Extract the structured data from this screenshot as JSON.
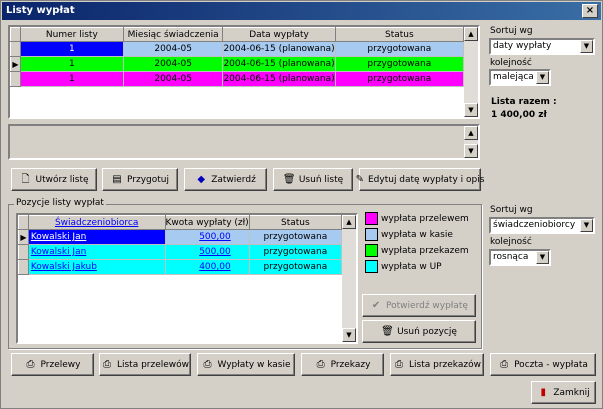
{
  "window": {
    "title": "Listy wypłat",
    "close_label": "×"
  },
  "lists_table": {
    "columns": [
      "Numer listy",
      "Miesiąc świadczenia",
      "Data wypłaty",
      "Status"
    ],
    "rows": [
      {
        "numer": "1",
        "miesiac": "2004-05",
        "data": "2004-06-15 (planowana)",
        "status": "przygotowana",
        "color": "#0000ff",
        "current": false
      },
      {
        "numer": "1",
        "miesiac": "2004-05",
        "data": "2004-06-15 (planowana)",
        "status": "przygotowana",
        "color": "#00ff00",
        "current": true
      },
      {
        "numer": "1",
        "miesiac": "2004-05",
        "data": "2004-06-15 (planowana)",
        "status": "przygotowana",
        "color": "#ff00ff",
        "current": false
      }
    ],
    "row_status_colors": {
      "first_row_status_bg": "#a6caf0"
    }
  },
  "sort_top": {
    "label": "Sortuj wg",
    "value": "daty wypłaty",
    "order_label": "kolejność",
    "order_value": "malejąca"
  },
  "total": {
    "label": "Lista razem :",
    "value": "1 400,00 zł"
  },
  "toolbar": {
    "create": "Utwórz listę",
    "prepare": "Przygotuj",
    "approve": "Zatwierdź",
    "delete": "Usuń listę",
    "edit_date": "Edytuj datę wypłaty i opis"
  },
  "positions": {
    "group_title": "Pozycje listy wypłat",
    "columns": [
      "Świadczeniobiorca",
      "Kwota wypłaty (zł)",
      "Status"
    ],
    "rows": [
      {
        "name": "Kowalski Jan",
        "amount": "500,00",
        "status": "przygotowana",
        "color": "#0000ff",
        "current": true
      },
      {
        "name": "Kowalski Jan",
        "amount": "500,00",
        "status": "przygotowana",
        "color": "#00ffff",
        "current": false
      },
      {
        "name": "Kowalski Jakub",
        "amount": "400,00",
        "status": "przygotowana",
        "color": "#00ffff",
        "current": false
      }
    ]
  },
  "legend": [
    {
      "label": "wypłata przelewem",
      "color": "#ff00ff"
    },
    {
      "label": "wypłata w kasie",
      "color": "#a6caf0"
    },
    {
      "label": "wypłata przekazem",
      "color": "#00ff00"
    },
    {
      "label": "wypłata w UP",
      "color": "#00ffff"
    }
  ],
  "positions_buttons": {
    "confirm": "Potwierdź wypłatę",
    "delete": "Usuń pozycję"
  },
  "sort_bottom": {
    "label": "Sortuj wg",
    "value": "świadczeniobiorcy",
    "order_label": "kolejność",
    "order_value": "rosnąca"
  },
  "bottom_buttons": {
    "transfers": "Przelewy",
    "transfer_list": "Lista przelewów",
    "cash_payments": "Wypłaty w kasie",
    "money_orders": "Przekazy",
    "money_order_list": "Lista przekazów",
    "post_payment": "Poczta - wypłata",
    "close": "Zamknij"
  },
  "icons": [
    "close-icon",
    "new-document-icon",
    "prepare-icon",
    "approve-icon",
    "trash-icon",
    "edit-icon",
    "check-icon",
    "printer-icon",
    "exit-icon",
    "row-pointer-icon"
  ]
}
